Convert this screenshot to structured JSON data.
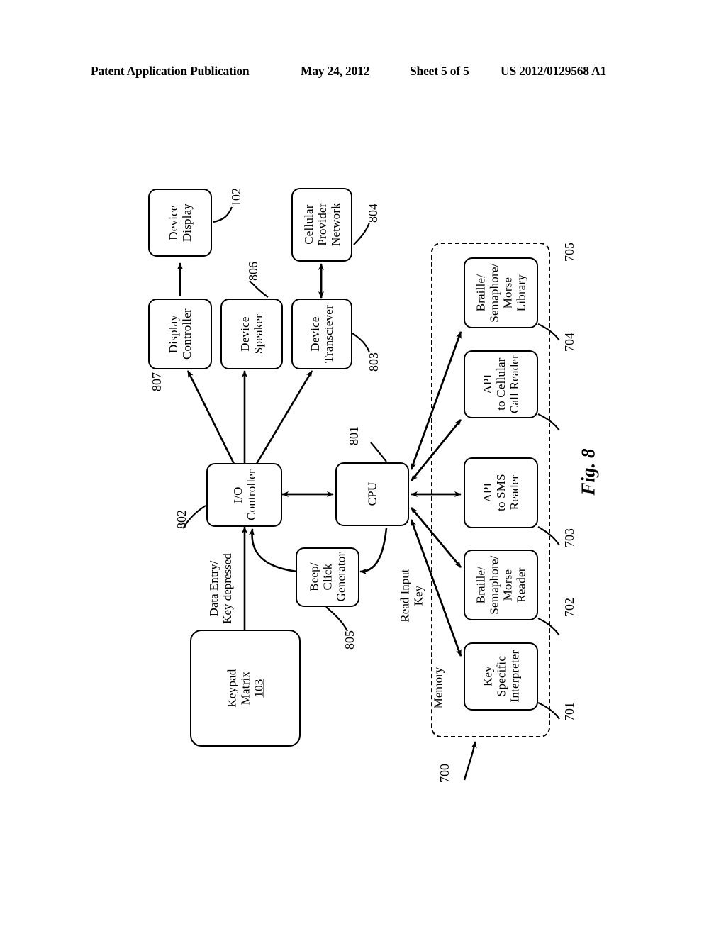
{
  "header": {
    "publication": "Patent Application Publication",
    "date": "May 24, 2012",
    "sheet": "Sheet 5 of 5",
    "document_number": "US 2012/0129568 A1"
  },
  "figure": {
    "caption": "Fig. 8",
    "memory_region_label": "Memory",
    "memory_region_ref": "700"
  },
  "nodes": {
    "device_display": {
      "line1": "Device",
      "line2": "Display",
      "ref": "102"
    },
    "display_controller": {
      "line1": "Display",
      "line2": "Controller",
      "ref": "807"
    },
    "device_speaker": {
      "line1": "Device",
      "line2": "Speaker",
      "ref": "806"
    },
    "device_transciever": {
      "line1": "Device",
      "line2": "Transciever",
      "ref": "803"
    },
    "cellular_provider_network": {
      "line1": "Cellular",
      "line2": "Provider",
      "line3": "Network",
      "ref": "804"
    },
    "io_controller": {
      "line1": "I/O",
      "line2": "Controller",
      "ref": "802"
    },
    "cpu": {
      "line1": "CPU",
      "ref": "801"
    },
    "beep_click_generator": {
      "line1": "Beep/",
      "line2": "Click",
      "line3": "Generator",
      "ref": "805"
    },
    "keypad_matrix": {
      "line1": "Keypad",
      "line2": "Matrix",
      "ref": "103"
    },
    "key_specific_interpreter": {
      "line1": "Key",
      "line2": "Specific",
      "line3": "Interpreter",
      "ref": "701"
    },
    "braille_semaphore_morse_reader": {
      "line1": "Braille/",
      "line2": "Semaphore/",
      "line3": "Morse",
      "line4": "Reader",
      "ref": "702"
    },
    "api_to_sms_reader": {
      "line1": "API",
      "line2": "to SMS",
      "line3": "Reader",
      "ref": "703"
    },
    "api_to_cellular_call_reader": {
      "line1": "API",
      "line2": "to Cellular",
      "line3": "Call Reader",
      "ref": "704"
    },
    "braille_semaphore_morse_library": {
      "line1": "Braille/",
      "line2": "Semaphore/",
      "line3": "Morse",
      "line4": "Library",
      "ref": "705"
    }
  },
  "edge_captions": {
    "data_entry": {
      "line1": "Data Entry/",
      "line2": "Key depressed"
    },
    "read_input_key": {
      "line1": "Read Input",
      "line2": "Key"
    }
  }
}
